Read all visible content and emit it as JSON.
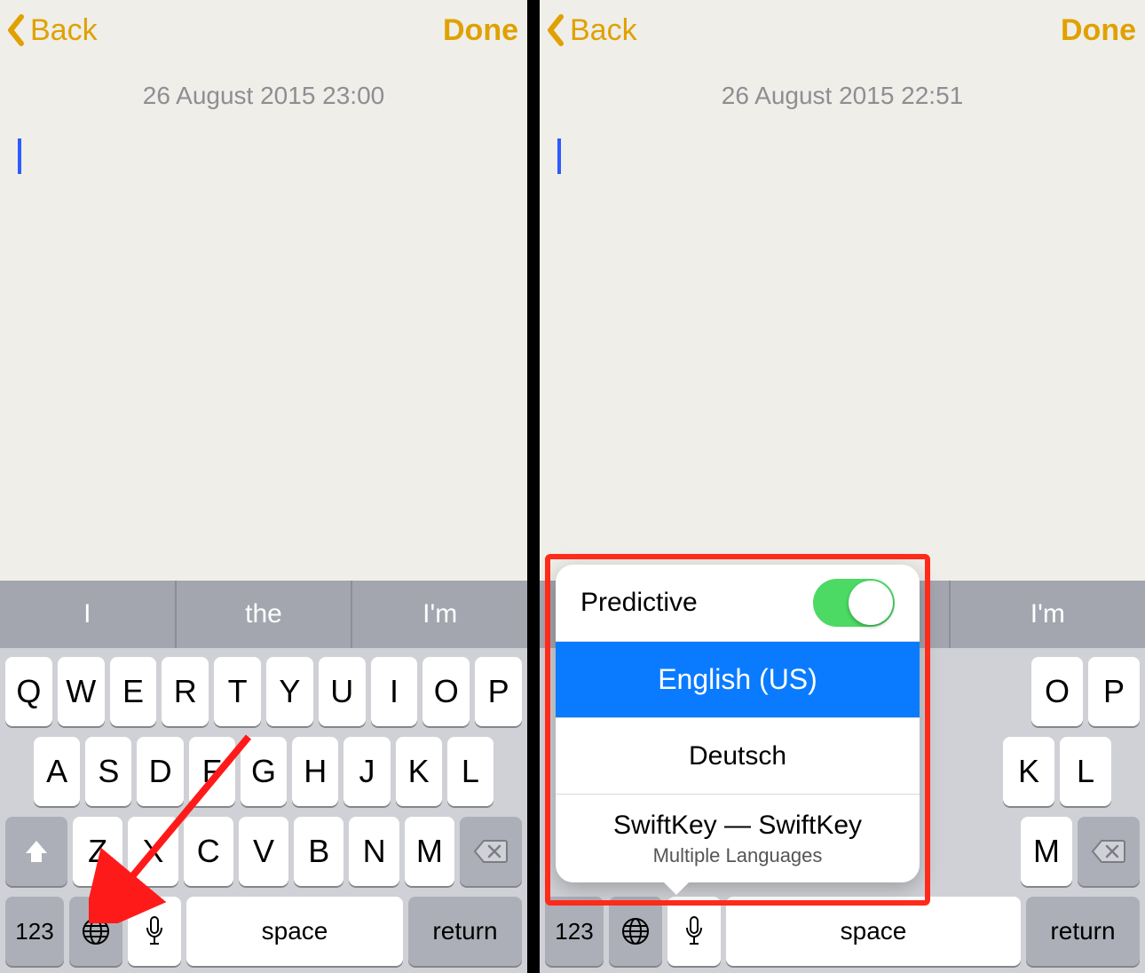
{
  "left": {
    "nav": {
      "back": "Back",
      "done": "Done"
    },
    "timestamp": "26 August 2015 23:00",
    "predictions": [
      "I",
      "the",
      "I'm"
    ],
    "keys": {
      "row1": [
        "Q",
        "W",
        "E",
        "R",
        "T",
        "Y",
        "U",
        "I",
        "O",
        "P"
      ],
      "row2": [
        "A",
        "S",
        "D",
        "F",
        "G",
        "H",
        "J",
        "K",
        "L"
      ],
      "row3": [
        "Z",
        "X",
        "C",
        "V",
        "B",
        "N",
        "M"
      ],
      "num": "123",
      "space": "space",
      "return": "return"
    }
  },
  "right": {
    "nav": {
      "back": "Back",
      "done": "Done"
    },
    "timestamp": "26 August 2015 22:51",
    "pred_visible": "I'm",
    "keys": {
      "row1_visible": [
        "O",
        "P"
      ],
      "row2_visible": [
        "K",
        "L"
      ],
      "row3_visible": [
        "M"
      ],
      "num": "123",
      "space": "space",
      "return": "return"
    },
    "popup": {
      "predictive_label": "Predictive",
      "predictive_on": true,
      "items": [
        {
          "label": "English (US)",
          "selected": true
        },
        {
          "label": "Deutsch",
          "selected": false
        }
      ],
      "swiftkey_title": "SwiftKey — SwiftKey",
      "swiftkey_sub": "Multiple Languages"
    }
  }
}
